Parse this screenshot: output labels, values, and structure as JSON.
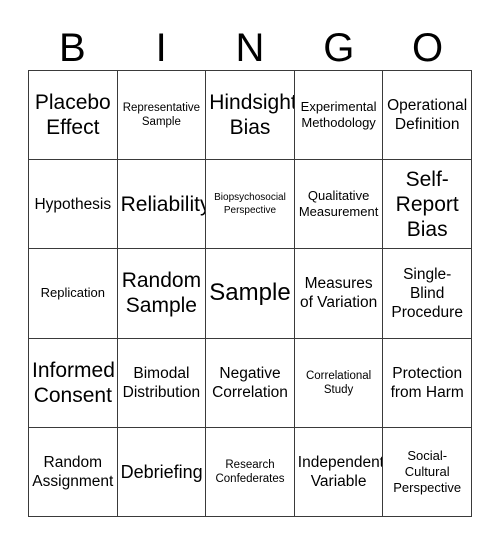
{
  "card": {
    "title": "BINGO",
    "header_letters": [
      "B",
      "I",
      "N",
      "G",
      "O"
    ],
    "columns": 5,
    "rows": 5,
    "border_color": "#3a3a3a",
    "background_color": "#ffffff",
    "text_color": "#000000"
  },
  "cells": [
    {
      "text": "Placebo Effect",
      "size": "fs-xxl"
    },
    {
      "text": "Representative Sample",
      "size": "fs-sm"
    },
    {
      "text": "Hindsight Bias",
      "size": "fs-xxl"
    },
    {
      "text": "Experimental Methodology",
      "size": "fs-md"
    },
    {
      "text": "Operational Definition",
      "size": "fs-lg"
    },
    {
      "text": "Hypothesis",
      "size": "fs-lg"
    },
    {
      "text": "Reliability",
      "size": "fs-xxl"
    },
    {
      "text": "Biopsychosocial Perspective",
      "size": "fs-xs"
    },
    {
      "text": "Qualitative Measurement",
      "size": "fs-md"
    },
    {
      "text": "Self-Report Bias",
      "size": "fs-xxl"
    },
    {
      "text": "Replication",
      "size": "fs-md"
    },
    {
      "text": "Random Sample",
      "size": "fs-xxl"
    },
    {
      "text": "Sample",
      "size": "fs-max"
    },
    {
      "text": "Measures of Variation",
      "size": "fs-lg"
    },
    {
      "text": "Single-Blind Procedure",
      "size": "fs-lg"
    },
    {
      "text": "Informed Consent",
      "size": "fs-xxl"
    },
    {
      "text": "Bimodal Distribution",
      "size": "fs-lg"
    },
    {
      "text": "Negative Correlation",
      "size": "fs-lg"
    },
    {
      "text": "Correlational Study",
      "size": "fs-sm"
    },
    {
      "text": "Protection from Harm",
      "size": "fs-lg"
    },
    {
      "text": "Random Assignment",
      "size": "fs-lg"
    },
    {
      "text": "Debriefing",
      "size": "fs-xl"
    },
    {
      "text": "Research Confederates",
      "size": "fs-sm"
    },
    {
      "text": "Independent Variable",
      "size": "fs-lg"
    },
    {
      "text": "Social-Cultural Perspective",
      "size": "fs-md"
    }
  ]
}
